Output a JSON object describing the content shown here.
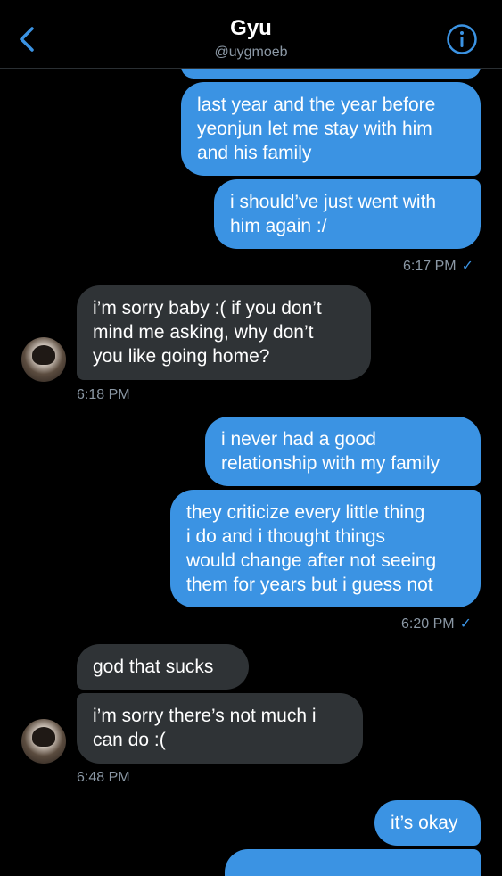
{
  "header": {
    "name": "Gyu",
    "handle": "@uygmoeb",
    "back_icon": "chevron-left-icon",
    "info_icon": "info-icon",
    "accent": "#3b93e3"
  },
  "messages": [
    {
      "text": "last year and the year before\nyeonjun let me stay with him\nand his family"
    },
    {
      "text": "i should’ve just went with\nhim again :/"
    },
    {
      "time": "6:17 PM",
      "check": "✓"
    },
    {
      "text": "i’m sorry baby :( if you don’t\nmind me asking, why don’t\nyou like going home?"
    },
    {
      "time": "6:18 PM"
    },
    {
      "text": "i never had a good\nrelationship with my family"
    },
    {
      "text": "they criticize every little thing\ni do and i thought things\nwould change after not seeing\nthem for years but i guess not"
    },
    {
      "time": "6:20 PM",
      "check": "✓"
    },
    {
      "text": "god that sucks"
    },
    {
      "text": "i’m sorry there’s not much i\ncan do :("
    },
    {
      "time": "6:48 PM"
    },
    {
      "text": "it’s okay"
    }
  ]
}
